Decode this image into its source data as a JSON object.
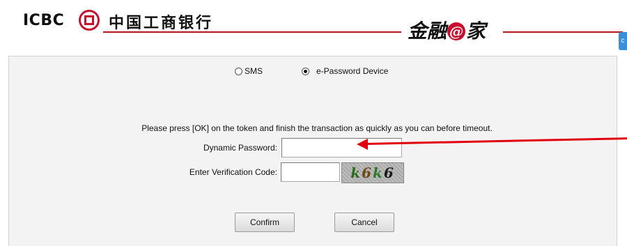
{
  "header": {
    "brand_en": "ICBC",
    "brand_cn": "中国工商银行",
    "slogan_pre": "金融",
    "slogan_at": "@",
    "slogan_post": "家",
    "side_tab": "c"
  },
  "auth_method": {
    "options": [
      {
        "label": "SMS",
        "selected": false
      },
      {
        "label": "e-Password Device",
        "selected": true
      }
    ]
  },
  "instruction": "Please press [OK] on the token and finish the transaction as quickly as you can before timeout.",
  "form": {
    "dynamic_password_label": "Dynamic Password:",
    "dynamic_password_value": "",
    "verification_label": "Enter Verification Code:",
    "verification_value": "",
    "captcha_chars": [
      "k",
      "6",
      "k",
      "6"
    ]
  },
  "buttons": {
    "confirm": "Confirm",
    "cancel": "Cancel"
  },
  "colors": {
    "brand_red": "#c8102e",
    "annotation_red": "#e0000f",
    "panel_bg": "#f3f3f3"
  }
}
